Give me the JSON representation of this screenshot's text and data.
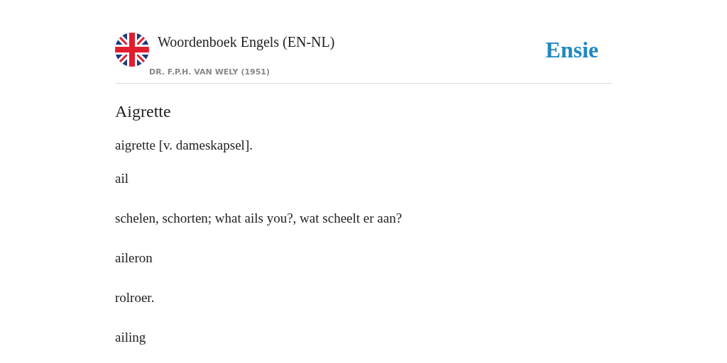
{
  "header": {
    "title": "Woordenboek Engels (EN-NL)",
    "subtitle": "DR. F.P.H. VAN WELY (1951)",
    "brand": "Ensie"
  },
  "heading": "Aigrette",
  "entries": [
    {
      "text": "aigrette [v. dameskapsel]."
    },
    {
      "text": "ail"
    },
    {
      "text": "schelen, schorten; what ails you?, wat scheelt er aan?"
    },
    {
      "text": "aileron"
    },
    {
      "text": "rolroer."
    },
    {
      "text": "ailing"
    }
  ]
}
